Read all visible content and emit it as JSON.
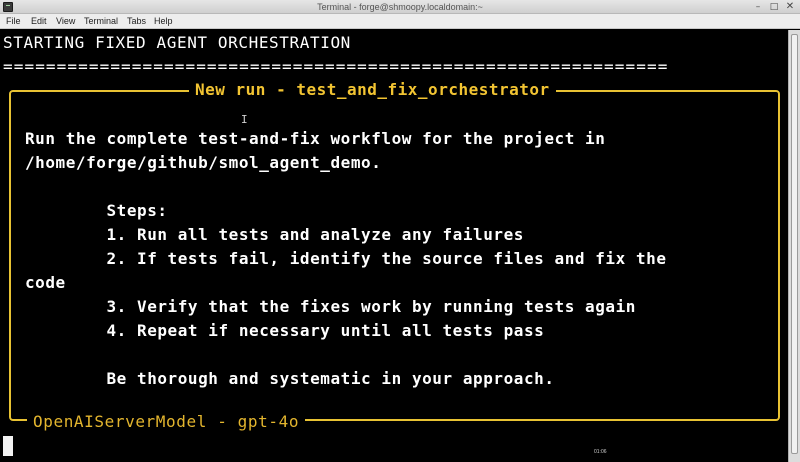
{
  "window": {
    "title": "Terminal - forge@shmoopy.localdomain:~",
    "controls": {
      "minimize": "–",
      "maximize": "□",
      "close": "✕"
    }
  },
  "menubar": {
    "items": [
      "File",
      "Edit",
      "View",
      "Terminal",
      "Tabs",
      "Help"
    ]
  },
  "terminal": {
    "header_line": "STARTING FIXED AGENT ORCHESTRATION",
    "separator": "==============================================================",
    "panel": {
      "title": "New run - test_and_fix_orchestrator",
      "lines": [
        "Run the complete test-and-fix workflow for the project in",
        "/home/forge/github/smol_agent_demo.",
        "",
        "        Steps:",
        "        1. Run all tests and analyze any failures",
        "        2. If tests fail, identify the source files and fix the",
        "code",
        "        3. Verify that the fixes work by running tests again",
        "        4. Repeat if necessary until all tests pass",
        "",
        "        Be thorough and systematic in your approach."
      ],
      "subtitle": "OpenAIServerModel - gpt-4o"
    },
    "size_indicator": "01:06"
  },
  "colors": {
    "background": "#000000",
    "text": "#ffffff",
    "accent": "#e8c233"
  },
  "icons": {
    "app": "terminal-icon",
    "text_cursor": "i-beam-cursor-icon"
  }
}
